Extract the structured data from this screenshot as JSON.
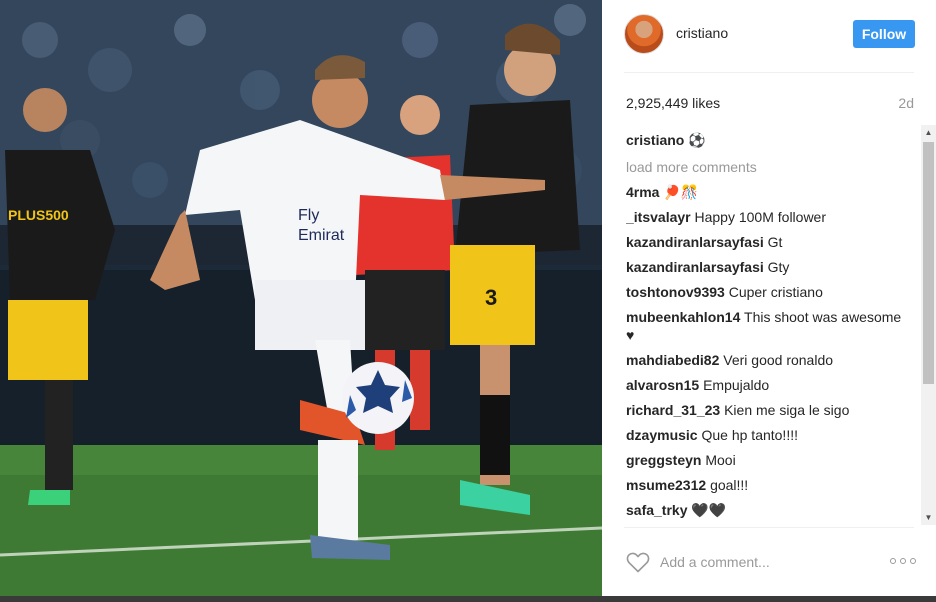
{
  "post": {
    "username": "cristiano",
    "follow_label": "Follow",
    "likes": "2,925,449 likes",
    "time_ago": "2d",
    "caption_user": "cristiano",
    "caption_text": "⚽",
    "load_more": "load more comments",
    "comments": [
      {
        "user": "4rma",
        "text": "🏓🎊"
      },
      {
        "user": "_itsvalayr",
        "text": "Happy 100M follower"
      },
      {
        "user": "kazandiranlarsayfasi",
        "text": "Gt"
      },
      {
        "user": "kazandiranlarsayfasi",
        "text": "Gty"
      },
      {
        "user": "toshtonov9393",
        "text": "Cuper cristiano"
      },
      {
        "user": "mubeenkahlon14",
        "text": "This shoot was awesome ♥"
      },
      {
        "user": "mahdiabedi82",
        "text": "Veri good ronaldo"
      },
      {
        "user": "alvarosn15",
        "text": "Empujaldo"
      },
      {
        "user": "richard_31_23",
        "text": "Kien me siga le sigo"
      },
      {
        "user": "dzaymusic",
        "text": "Que hp tanto!!!!"
      },
      {
        "user": "greggsteyn",
        "text": "Mooi"
      },
      {
        "user": "msume2312",
        "text": "goal!!!"
      },
      {
        "user": "safa_trky",
        "text": "🖤🖤"
      }
    ],
    "add_comment_placeholder": "Add a comment...",
    "photo_description_icon": "football-photo"
  },
  "icons": {
    "like": "heart-outline-icon",
    "more": "more-options-icon"
  },
  "colors": {
    "follow_button": "#3897f0",
    "muted_text": "#999999",
    "text": "#262626"
  }
}
